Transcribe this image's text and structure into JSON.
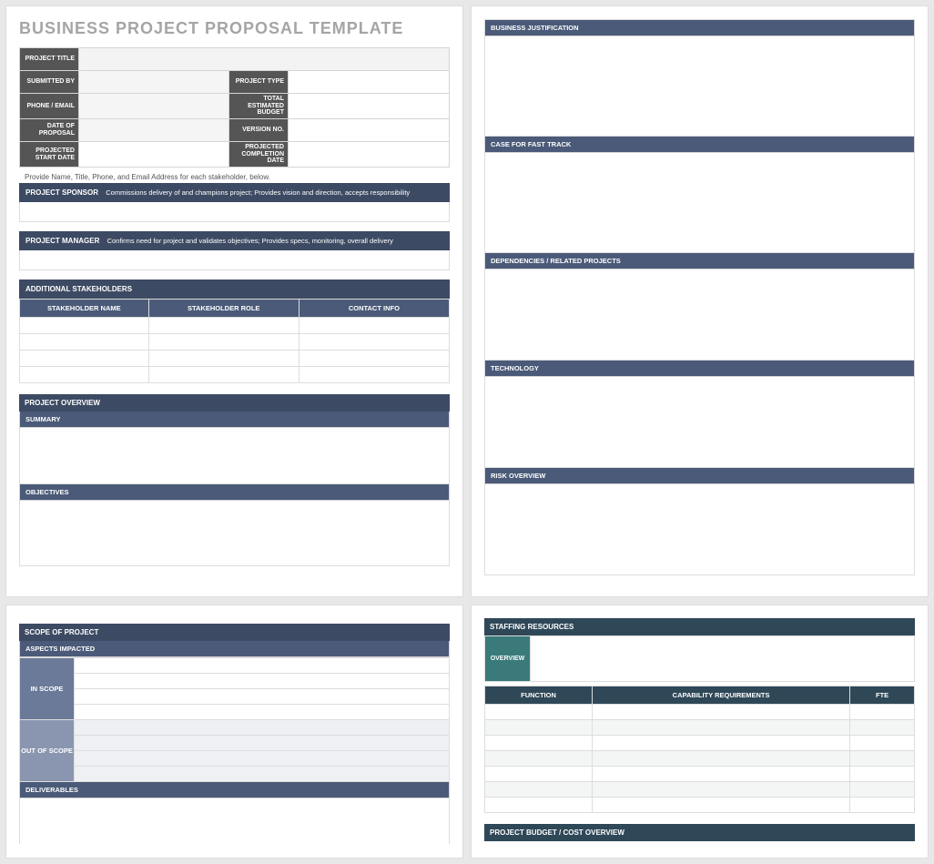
{
  "title": "BUSINESS PROJECT PROPOSAL TEMPLATE",
  "meta": {
    "project_title": "PROJECT TITLE",
    "submitted_by": "SUBMITTED BY",
    "project_type": "PROJECT TYPE",
    "phone_email": "PHONE / EMAIL",
    "total_budget": "TOTAL ESTIMATED BUDGET",
    "date_of_proposal": "DATE OF PROPOSAL",
    "version_no": "VERSION NO.",
    "projected_start": "PROJECTED START DATE",
    "projected_end": "PROJECTED COMPLETION DATE"
  },
  "note": "Provide Name, Title, Phone, and Email Address for each stakeholder, below.",
  "sponsor": {
    "label": "PROJECT SPONSOR",
    "desc": "Commissions delivery of and champions project; Provides vision and direction, accepts responsibility"
  },
  "manager": {
    "label": "PROJECT MANAGER",
    "desc": "Confirms need for project and validates objectives; Provides specs, monitoring, overall delivery"
  },
  "stakeholders": {
    "header": "ADDITIONAL STAKEHOLDERS",
    "cols": [
      "STAKEHOLDER NAME",
      "STAKEHOLDER ROLE",
      "CONTACT INFO"
    ]
  },
  "overview": {
    "header": "PROJECT OVERVIEW",
    "summary": "SUMMARY",
    "objectives": "OBJECTIVES"
  },
  "right": {
    "biz": "BUSINESS JUSTIFICATION",
    "fast": "CASE FOR FAST TRACK",
    "dep": "DEPENDENCIES / RELATED PROJECTS",
    "tech": "TECHNOLOGY",
    "risk": "RISK OVERVIEW"
  },
  "scope": {
    "header": "SCOPE OF PROJECT",
    "aspects": "ASPECTS IMPACTED",
    "in": "IN SCOPE",
    "out": "OUT OF SCOPE",
    "deliv": "DELIVERABLES"
  },
  "staff": {
    "header": "STAFFING RESOURCES",
    "overview": "OVERVIEW",
    "cols": [
      "FUNCTION",
      "CAPABILITY REQUIREMENTS",
      "FTE"
    ],
    "budget": "PROJECT BUDGET / COST OVERVIEW"
  }
}
